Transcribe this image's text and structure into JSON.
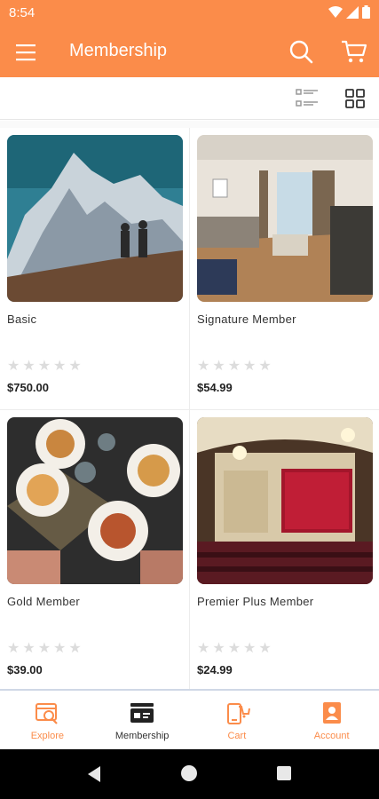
{
  "status": {
    "time": "8:54"
  },
  "appbar": {
    "title": "Membership",
    "icons": [
      "menu-icon",
      "search-icon",
      "cart-icon"
    ]
  },
  "viewbar": {
    "icons": [
      "list-view-icon",
      "grid-view-icon"
    ]
  },
  "products": [
    {
      "name": "Basic",
      "price": "$750.00",
      "rating": 0,
      "image": "mountain-hikers"
    },
    {
      "name": "Signature Member",
      "price": "$54.99",
      "rating": 0,
      "image": "living-room"
    },
    {
      "name": "Gold Member",
      "price": "$39.00",
      "rating": 0,
      "image": "dining-table"
    },
    {
      "name": "Premier Plus Member",
      "price": "$24.99",
      "rating": 0,
      "image": "theater"
    }
  ],
  "bottom_nav": [
    {
      "label": "Explore",
      "icon": "explore-icon",
      "active": false
    },
    {
      "label": "Membership",
      "icon": "membership-icon",
      "active": true
    },
    {
      "label": "Cart",
      "icon": "cart-icon",
      "active": false
    },
    {
      "label": "Account",
      "icon": "account-icon",
      "active": false
    }
  ],
  "colors": {
    "accent": "#fb8c4a",
    "star_empty": "#dcdcdc"
  }
}
